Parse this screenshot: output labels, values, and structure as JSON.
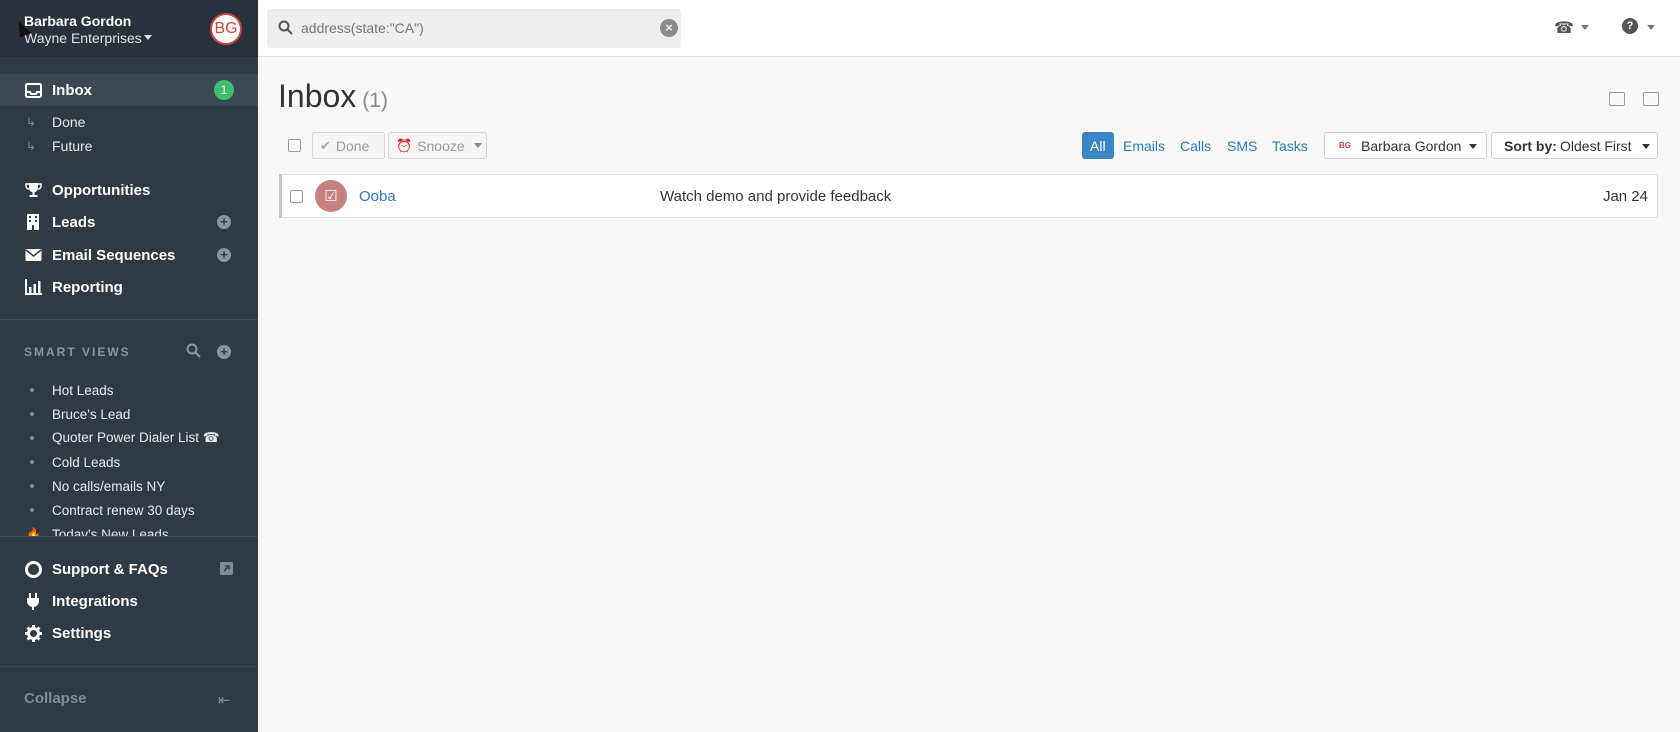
{
  "account": {
    "name": "Barbara Gordon",
    "org": "Wayne Enterprises",
    "initials": "BG"
  },
  "nav": {
    "inbox": {
      "label": "Inbox",
      "badge": "1"
    },
    "done": "Done",
    "future": "Future",
    "opportunities": "Opportunities",
    "leads": "Leads",
    "email_sequences": "Email Sequences",
    "reporting": "Reporting",
    "plus": "+"
  },
  "smart_views": {
    "header": "SMART VIEWS",
    "items": [
      "Hot Leads",
      "Bruce's Lead",
      "Quoter Power Dialer List ☎",
      "Cold Leads",
      "No calls/emails NY",
      "Contract renew 30 days",
      "Today's New Leads"
    ]
  },
  "bottom_nav": {
    "support": "Support & FAQs",
    "integrations": "Integrations",
    "settings": "Settings",
    "collapse": "Collapse"
  },
  "search": {
    "value": "address(state:\"CA\")"
  },
  "icons": {
    "phone": "☎",
    "help": "?",
    "check": "✔",
    "alarm": "⏰",
    "task": "☑",
    "collapse": "⇤",
    "fire": "🔥",
    "clear": "×"
  },
  "main": {
    "title": "Inbox",
    "count": "(1)",
    "done_button": "Done",
    "snooze_button": "Snooze",
    "filters": [
      "All",
      "Emails",
      "Calls",
      "SMS",
      "Tasks"
    ],
    "user_filter": "Barbara Gordon",
    "sort_label": "Sort by:",
    "sort_value": "Oldest First"
  },
  "rows": [
    {
      "lead": "Ooba",
      "subject": "Watch demo and provide feedback",
      "date": "Jan 24"
    }
  ],
  "colors": {
    "sidebar": "#2e3a45",
    "accent": "#3a86c4",
    "badge": "#3bbf6d",
    "avatar": "#d0443c"
  }
}
